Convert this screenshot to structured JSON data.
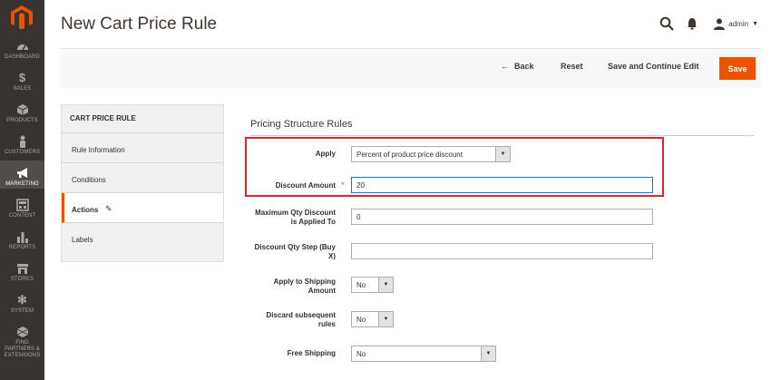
{
  "page": {
    "title": "New Cart Price Rule"
  },
  "header": {
    "user_name": "admin"
  },
  "nav": [
    {
      "key": "dashboard",
      "label": "DASHBOARD",
      "icon": "dashboard-icon"
    },
    {
      "key": "sales",
      "label": "SALES",
      "icon": "dollar-icon"
    },
    {
      "key": "products",
      "label": "PRODUCTS",
      "icon": "cube-icon"
    },
    {
      "key": "customers",
      "label": "CUSTOMERS",
      "icon": "person-icon"
    },
    {
      "key": "marketing",
      "label": "MARKETING",
      "icon": "megaphone-icon"
    },
    {
      "key": "content",
      "label": "CONTENT",
      "icon": "layout-icon"
    },
    {
      "key": "reports",
      "label": "REPORTS",
      "icon": "bar-chart-icon"
    },
    {
      "key": "stores",
      "label": "STORES",
      "icon": "store-icon"
    },
    {
      "key": "system",
      "label": "SYSTEM",
      "icon": "gear-icon"
    },
    {
      "key": "partners",
      "label": "FIND PARTNERS & EXTENSIONS",
      "icon": "box-icon"
    }
  ],
  "toolbar": {
    "back": "Back",
    "reset": "Reset",
    "save_continue": "Save and Continue Edit",
    "save": "Save"
  },
  "tabs_panel": {
    "header": "CART PRICE RULE",
    "tabs": [
      {
        "label": "Rule Information"
      },
      {
        "label": "Conditions"
      },
      {
        "label": "Actions"
      },
      {
        "label": "Labels"
      }
    ]
  },
  "section": {
    "title": "Pricing Structure Rules"
  },
  "fields": {
    "apply": {
      "label": "Apply",
      "value": "Percent of product price discount"
    },
    "discount_amount": {
      "label": "Discount Amount",
      "value": "20"
    },
    "max_qty": {
      "label_line1": "Maximum Qty Discount",
      "label_line2": "is Applied To",
      "value": "0"
    },
    "qty_step": {
      "label_line1": "Discount Qty Step (Buy",
      "label_line2": "X)",
      "value": ""
    },
    "apply_shipping": {
      "label_line1": "Apply to Shipping",
      "label_line2": "Amount",
      "value": "No"
    },
    "discard_rules": {
      "label_line1": "Discard subsequent",
      "label_line2": "rules",
      "value": "No"
    },
    "free_shipping": {
      "label": "Free Shipping",
      "value": "No"
    }
  },
  "colors": {
    "sidebar": "#373330",
    "accent": "#eb5202",
    "highlight": "#e0242b",
    "focus": "#007bdb"
  }
}
